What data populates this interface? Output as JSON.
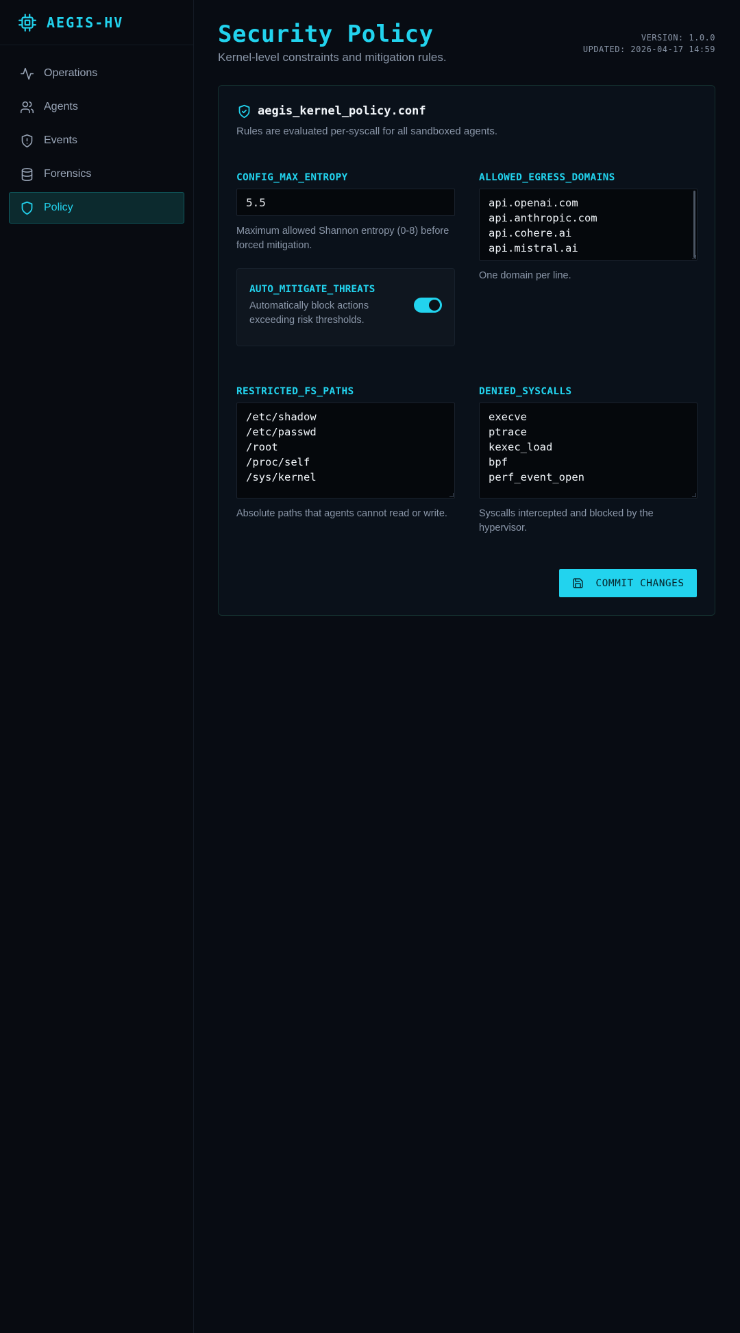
{
  "app": {
    "name": "AEGIS-HV"
  },
  "sidebar": {
    "items": [
      {
        "label": "Operations",
        "icon": "activity-icon"
      },
      {
        "label": "Agents",
        "icon": "users-icon"
      },
      {
        "label": "Events",
        "icon": "shield-alert-icon"
      },
      {
        "label": "Forensics",
        "icon": "database-icon"
      },
      {
        "label": "Policy",
        "icon": "shield-icon",
        "active": true
      }
    ]
  },
  "header": {
    "title": "Security Policy",
    "subtitle": "Kernel-level constraints and mitigation rules.",
    "version": "VERSION: 1.0.0",
    "updated": "UPDATED: 2026-04-17 14:59"
  },
  "policy": {
    "file_name": "aegis_kernel_policy.conf",
    "description": "Rules are evaluated per-syscall for all sandboxed agents.",
    "max_entropy": {
      "label": "CONFIG_MAX_ENTROPY",
      "value": "5.5",
      "help": "Maximum allowed Shannon entropy (0-8) before forced mitigation."
    },
    "egress": {
      "label": "ALLOWED_EGRESS_DOMAINS",
      "lines": [
        "api.openai.com",
        "api.anthropic.com",
        "api.cohere.ai",
        "api.mistral.ai"
      ],
      "help": "One domain per line."
    },
    "auto_mitigate": {
      "label": "AUTO_MITIGATE_THREATS",
      "description": "Automatically block actions exceeding risk thresholds.",
      "enabled": true
    },
    "fs_paths": {
      "label": "RESTRICTED_FS_PATHS",
      "lines": [
        "/etc/shadow",
        "/etc/passwd",
        "/root",
        "/proc/self",
        "/sys/kernel"
      ],
      "help": "Absolute paths that agents cannot read or write."
    },
    "syscalls": {
      "label": "DENIED_SYSCALLS",
      "lines": [
        "execve",
        "ptrace",
        "kexec_load",
        "bpf",
        "perf_event_open"
      ],
      "help": "Syscalls intercepted and blocked by the hypervisor."
    },
    "commit_label": "COMMIT CHANGES"
  },
  "colors": {
    "accent": "#22d3ee",
    "background": "#080c13",
    "card": "#0a111a",
    "muted_text": "#8a96a8"
  }
}
